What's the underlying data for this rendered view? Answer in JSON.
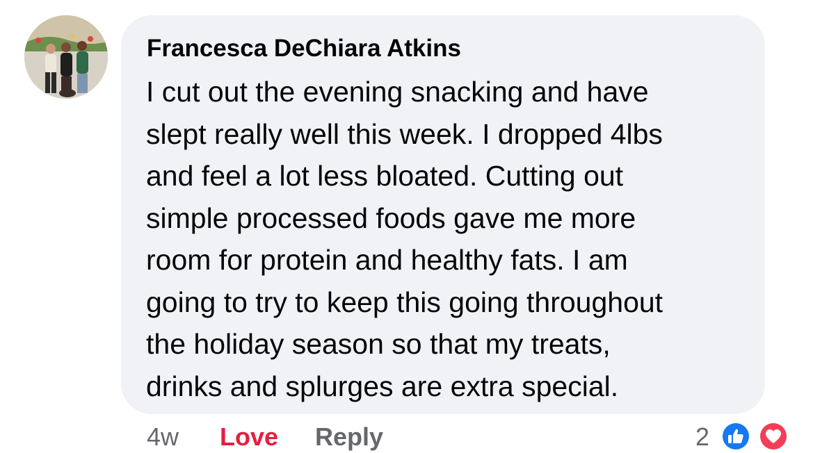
{
  "comment": {
    "author": "Francesca DeChiara Atkins",
    "text_lines": [
      "I cut out the evening snacking and have",
      "slept really well this week. I dropped 4lbs",
      "and feel a lot less bloated. Cutting out",
      "simple processed foods gave me more",
      "room for protein and healthy fats. I am",
      "going to try to keep this going throughout",
      "the holiday season so that my treats,",
      "drinks and splurges are extra special."
    ],
    "timestamp": "4w",
    "reaction_action": "Love",
    "reply_label": "Reply",
    "reaction_count": "2",
    "reaction_icons": [
      "like-icon",
      "heart-icon"
    ]
  },
  "colors": {
    "bubble_bg": "#f0f2f5",
    "love_red": "#e41e3f",
    "like_blue": "#1877f2",
    "meta_gray": "#65676b",
    "text_dark": "#050505"
  }
}
